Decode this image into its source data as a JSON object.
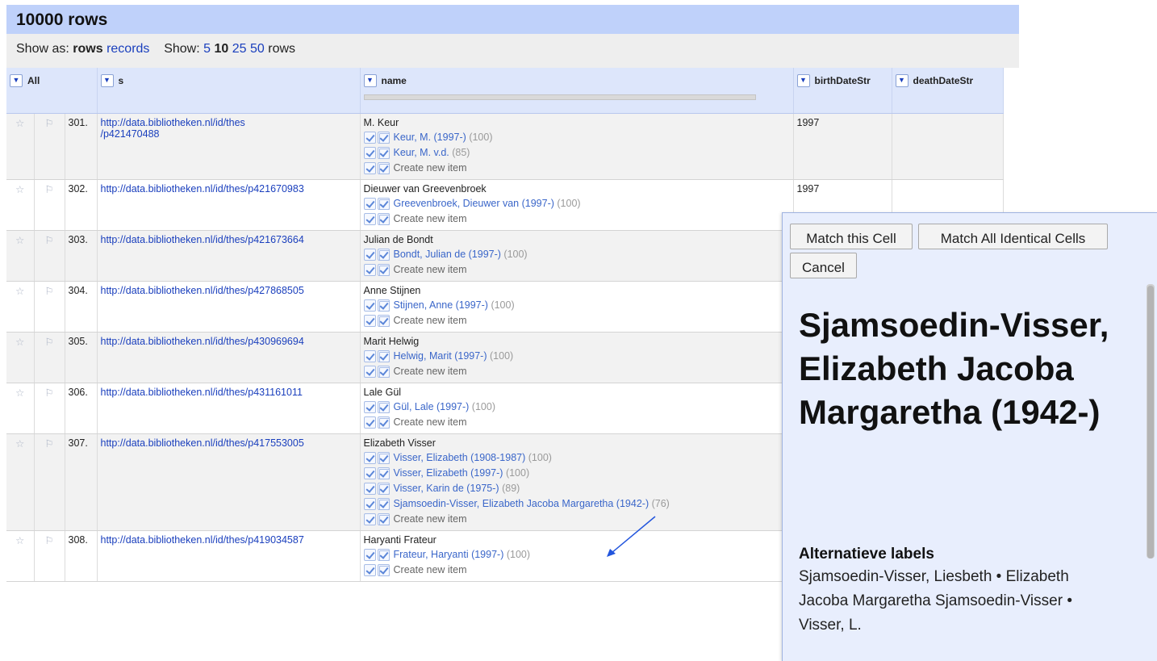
{
  "header": {
    "title": "10000 rows"
  },
  "show_bar": {
    "show_as_label": "Show as:",
    "mode_rows": "rows",
    "mode_records": "records",
    "show_label": "Show:",
    "counts": [
      "5",
      "10",
      "25",
      "50"
    ],
    "rows_suffix": "rows"
  },
  "columns": {
    "all": "All",
    "s": "s",
    "name": "name",
    "birth": "birthDateStr",
    "death": "deathDateStr"
  },
  "rows": [
    {
      "num": "301.",
      "s": "http://data.bibliotheken.nl/id/thes/p421470488",
      "s_line1": "http://data.bibliotheken.nl/id/thes",
      "s_line2": "/p421470488",
      "name": "M. Keur",
      "birth": "1997",
      "candidates": [
        {
          "text": "Keur, M. (1997-)",
          "score": "(100)"
        },
        {
          "text": "Keur, M. v.d.",
          "score": "(85)"
        }
      ]
    },
    {
      "num": "302.",
      "s": "http://data.bibliotheken.nl/id/thes/p421670983",
      "name": "Dieuwer van Greevenbroek",
      "birth": "1997",
      "candidates": [
        {
          "text": "Greevenbroek, Dieuwer van (1997-)",
          "score": "(100)"
        }
      ]
    },
    {
      "num": "303.",
      "s": "http://data.bibliotheken.nl/id/thes/p421673664",
      "name": "Julian de Bondt",
      "birth": "",
      "candidates": [
        {
          "text": "Bondt, Julian de (1997-)",
          "score": "(100)"
        }
      ]
    },
    {
      "num": "304.",
      "s": "http://data.bibliotheken.nl/id/thes/p427868505",
      "name": "Anne Stijnen",
      "birth": "",
      "candidates": [
        {
          "text": "Stijnen, Anne (1997-)",
          "score": "(100)"
        }
      ]
    },
    {
      "num": "305.",
      "s": "http://data.bibliotheken.nl/id/thes/p430969694",
      "name": "Marit Helwig",
      "birth": "",
      "candidates": [
        {
          "text": "Helwig, Marit (1997-)",
          "score": "(100)"
        }
      ]
    },
    {
      "num": "306.",
      "s": "http://data.bibliotheken.nl/id/thes/p431161011",
      "name": "Lale Gül",
      "birth": "",
      "candidates": [
        {
          "text": "Gül, Lale (1997-)",
          "score": "(100)"
        }
      ]
    },
    {
      "num": "307.",
      "s": "http://data.bibliotheken.nl/id/thes/p417553005",
      "name": "Elizabeth Visser",
      "birth": "",
      "candidates": [
        {
          "text": "Visser, Elizabeth (1908-1987)",
          "score": "(100)"
        },
        {
          "text": "Visser, Elizabeth (1997-)",
          "score": "(100)"
        },
        {
          "text": "Visser, Karin de (1975-)",
          "score": "(89)"
        },
        {
          "text": "Sjamsoedin-Visser, Elizabeth Jacoba Margaretha (1942-)",
          "score": "(76)"
        }
      ]
    },
    {
      "num": "308.",
      "s": "http://data.bibliotheken.nl/id/thes/p419034587",
      "name": "Haryanti Frateur",
      "birth": "",
      "candidates": [
        {
          "text": "Frateur, Haryanti (1997-)",
          "score": "(100)"
        }
      ]
    }
  ],
  "create_new_item": "Create new item",
  "popup": {
    "match_cell": "Match this Cell",
    "match_all": "Match All Identical Cells",
    "cancel": "Cancel",
    "title": "Sjamsoedin-Visser, Elizabeth Jacoba Margaretha (1942-)",
    "alt_heading": "Alternatieve labels",
    "alt_text": "Sjamsoedin-Visser, Liesbeth • Elizabeth Jacoba Margaretha Sjamsoedin-Visser • Visser, L."
  },
  "colors": {
    "header_bg": "#bfd1fa",
    "link": "#1a3fbd",
    "candidate": "#3a66c9",
    "popup_bg": "#e8eefd",
    "arrow": "#2255dd"
  },
  "icons": {
    "star": "star-icon",
    "flag": "flag-icon",
    "dropdown": "dropdown-icon",
    "check": "check-icon",
    "check_all": "check-all-icon"
  }
}
